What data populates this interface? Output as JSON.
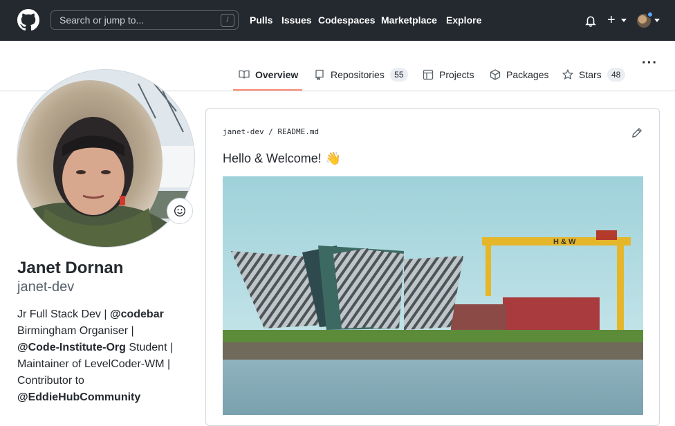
{
  "header": {
    "search_placeholder": "Search or jump to...",
    "slash_key": "/",
    "nav": [
      "Pulls",
      "Issues",
      "Codespaces",
      "Marketplace",
      "Explore"
    ]
  },
  "tabs": [
    {
      "label": "Overview",
      "active": true
    },
    {
      "label": "Repositories",
      "count": "55"
    },
    {
      "label": "Projects"
    },
    {
      "label": "Packages"
    },
    {
      "label": "Stars",
      "count": "48"
    }
  ],
  "profile": {
    "name": "Janet Dornan",
    "username": "janet-dev",
    "bio_1": "Jr Full Stack Dev | ",
    "bio_codebar": "@codebar",
    "bio_2": "Birmingham Organiser |",
    "bio_org": "@Code-Institute-Org",
    "bio_3": " Student |",
    "bio_4": "Maintainer of LevelCoder-WM |",
    "bio_5": "Contributor to",
    "bio_eddie": "@EddieHubCommunity"
  },
  "readme": {
    "path": "janet-dev / README.md",
    "heading": "Hello & Welcome!",
    "wave_emoji": "👋",
    "crane_sign": "H & W"
  },
  "colors": {
    "header_bg": "#24292f",
    "active_underline": "#fd8c73",
    "counter_bg": "#eaeef2",
    "border": "#d0d7de",
    "muted_text": "#57606a"
  }
}
